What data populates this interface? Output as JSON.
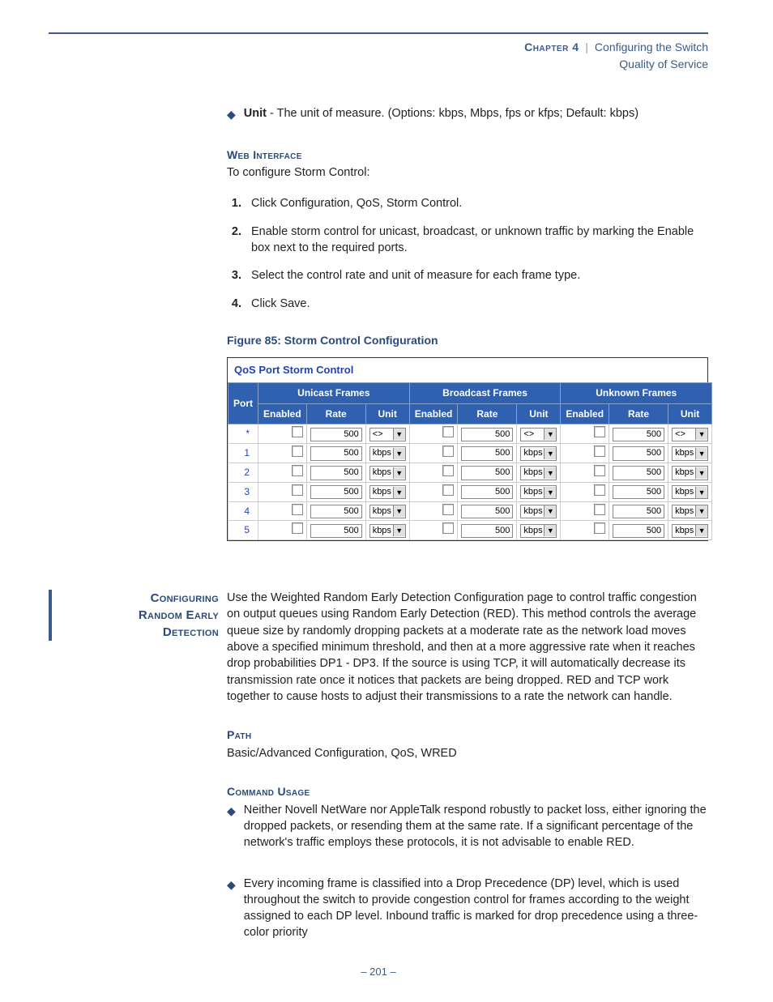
{
  "header": {
    "chapter": "Chapter 4",
    "separator": "|",
    "title": "Configuring the Switch",
    "subtitle": "Quality of Service"
  },
  "unit_bullet": {
    "label": "Unit",
    "text": " - The unit of measure. (Options: kbps, Mbps, fps or kfps; Default: kbps)"
  },
  "web_interface": {
    "heading": "Web Interface",
    "intro": "To configure Storm Control:",
    "steps": [
      "Click Configuration, QoS, Storm Control.",
      "Enable storm control for unicast, broadcast, or unknown traffic by marking the Enable box next to the required ports.",
      "Select the control rate and unit of measure for each frame type.",
      "Click Save."
    ]
  },
  "figure": {
    "caption": "Figure 85:  Storm Control Configuration",
    "panel_title": "QoS Port Storm Control",
    "columns": {
      "port": "Port",
      "groups": [
        "Unicast Frames",
        "Broadcast Frames",
        "Unknown Frames"
      ],
      "sub": [
        "Enabled",
        "Rate",
        "Unit"
      ]
    },
    "rows": [
      {
        "port": "*",
        "rate": "500",
        "unit": "<>"
      },
      {
        "port": "1",
        "rate": "500",
        "unit": "kbps"
      },
      {
        "port": "2",
        "rate": "500",
        "unit": "kbps"
      },
      {
        "port": "3",
        "rate": "500",
        "unit": "kbps"
      },
      {
        "port": "4",
        "rate": "500",
        "unit": "kbps"
      },
      {
        "port": "5",
        "rate": "500",
        "unit": "kbps"
      }
    ]
  },
  "red_section": {
    "side_title_lines": [
      "Configuring",
      "Random Early",
      "Detection"
    ],
    "body": "Use the Weighted Random Early Detection Configuration page to control traffic congestion on output queues using Random Early Detection (RED). This method controls the average queue size by randomly dropping packets at a moderate rate as the network load moves above a specified minimum threshold, and then at a more aggressive rate when it reaches drop probabilities DP1 - DP3. If the source is using TCP, it will automatically decrease its transmission rate once it notices that packets are being dropped. RED and TCP work together to cause hosts to adjust their transmissions to a rate the network can handle."
  },
  "path": {
    "heading": "Path",
    "text": "Basic/Advanced Configuration, QoS, WRED"
  },
  "command_usage": {
    "heading": "Command Usage",
    "bullets": [
      "Neither Novell NetWare nor AppleTalk respond robustly to packet loss, either ignoring the dropped packets, or resending them at the same rate. If a significant percentage of the network's traffic employs these protocols, it is not advisable to enable RED.",
      "Every incoming frame is classified into a Drop Precedence (DP) level, which is used throughout the switch to provide congestion control for frames according to the weight assigned to each DP level. Inbound traffic is marked for drop precedence using a three-color priority"
    ]
  },
  "footer": {
    "page": "–  201  –"
  }
}
